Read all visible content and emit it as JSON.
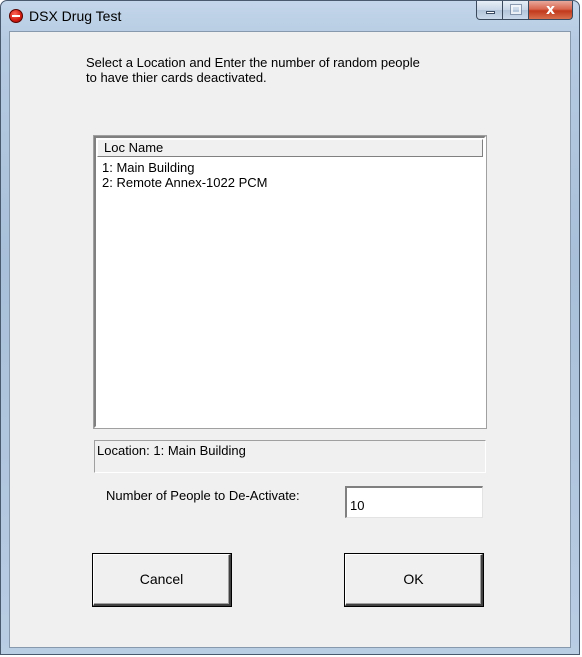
{
  "window": {
    "title": "DSX Drug Test",
    "close_glyph": "x",
    "icon": "stop-icon"
  },
  "instructions": "Select a Location and Enter the number of random people\nto have thier cards deactivated.",
  "location_list": {
    "column_header": "Loc Name",
    "items": [
      "1: Main Building",
      "2: Remote Annex-1022 PCM"
    ]
  },
  "status": {
    "selected_location": "Location: 1: Main Building"
  },
  "people_count": {
    "label": "Number of People to De-Activate:",
    "value": "10"
  },
  "buttons": {
    "cancel_label": "Cancel",
    "ok_label": "OK"
  }
}
